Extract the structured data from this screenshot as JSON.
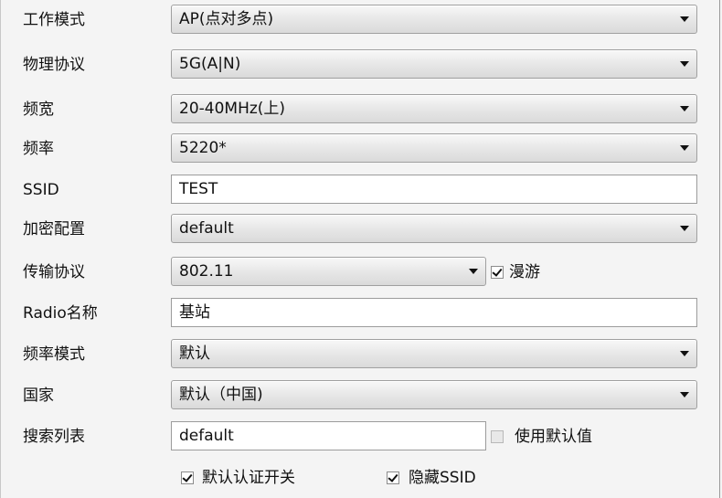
{
  "fields": {
    "work_mode": {
      "label": "工作模式",
      "value": "AP(点对多点)"
    },
    "physical_protocol": {
      "label": "物理协议",
      "value": "5G(A|N)"
    },
    "bandwidth": {
      "label": "频宽",
      "value": "20-40MHz(上)"
    },
    "frequency": {
      "label": "频率",
      "value": "5220*"
    },
    "ssid": {
      "label": "SSID",
      "value": "TEST"
    },
    "encryption": {
      "label": "加密配置",
      "value": "default"
    },
    "transport_protocol": {
      "label": "传输协议",
      "value": "802.11"
    },
    "roaming": {
      "label": "漫游",
      "checked": true
    },
    "radio_name": {
      "label": "Radio名称",
      "value": "基站"
    },
    "frequency_mode": {
      "label": "频率模式",
      "value": "默认"
    },
    "country": {
      "label": "国家",
      "value": "默认（中国)"
    },
    "search_list": {
      "label": "搜索列表",
      "value": "default"
    },
    "use_default": {
      "label": "使用默认值",
      "checked": false,
      "enabled": false
    },
    "auth_switch": {
      "label": "默认认证开关",
      "checked": true
    },
    "hide_ssid": {
      "label": "隐藏SSID",
      "checked": true
    }
  }
}
